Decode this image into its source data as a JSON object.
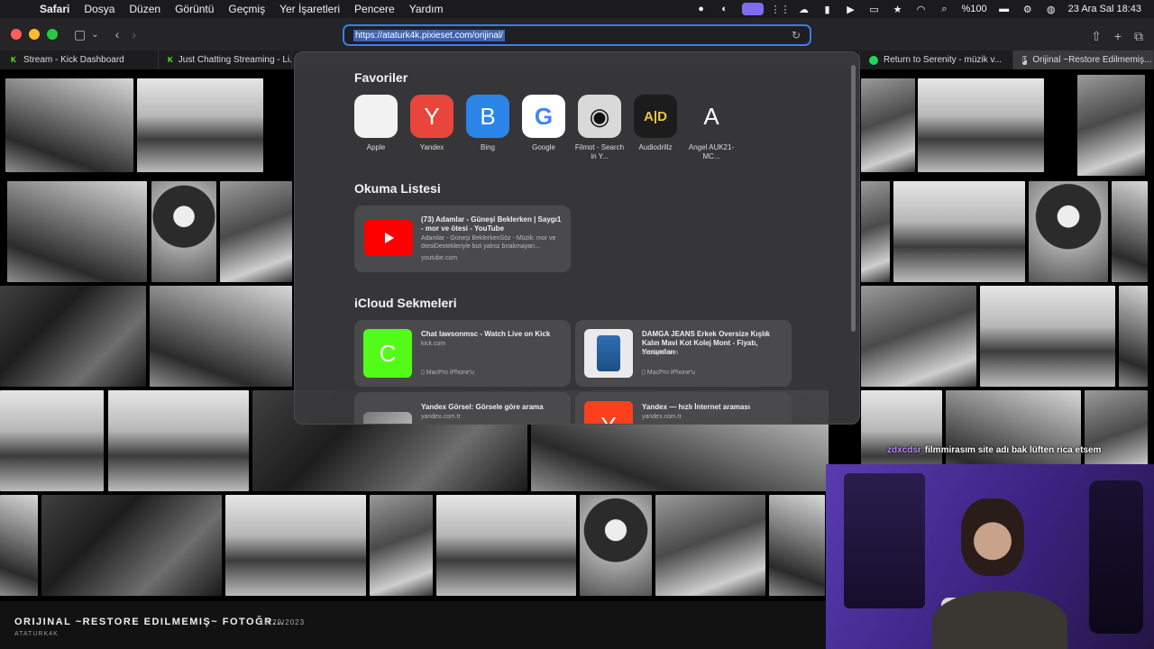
{
  "menubar": {
    "app": "Safari",
    "items": [
      "Dosya",
      "Düzen",
      "Görüntü",
      "Geçmiş",
      "Yer İşaretleri",
      "Pencere",
      "Yardım"
    ],
    "battery": "%100",
    "datetime": "23 Ara Sal  18:43"
  },
  "toolbar": {
    "url": "https://ataturk4k.pixieset.com/orijinal/"
  },
  "tabs": [
    {
      "label": "Stream - Kick Dashboard"
    },
    {
      "label": "Just Chatting Streaming - Li..."
    },
    {
      "label": "Return to Serenity - müzik v..."
    },
    {
      "label": "Orijinal ~Restore Edilmemiş..."
    }
  ],
  "start_page": {
    "favorites_title": "Favoriler",
    "favorites": [
      {
        "label": "Apple",
        "glyph": ""
      },
      {
        "label": "Yandex",
        "glyph": "Y"
      },
      {
        "label": "Bing",
        "glyph": "B"
      },
      {
        "label": "Google",
        "glyph": "G"
      },
      {
        "label": "Filmot - Search in Y...",
        "glyph": "◉"
      },
      {
        "label": "Audiodrillz",
        "glyph": "A|D"
      },
      {
        "label": "Angel AUK21-MC...",
        "glyph": "A"
      }
    ],
    "reading_list_title": "Okuma Listesi",
    "reading_list": [
      {
        "title": "(73) Adamlar - Güneşi Beklerken | Saygı1 - mor ve ötesi - YouTube",
        "desc": "Adamlar - Güneşi BeklerkenSöz - Müzik: mor ve ötesiDestekleriyle bizi yalnız bırakmayan...",
        "url": "youtube.com"
      }
    ],
    "icloud_title": "iCloud Sekmeleri",
    "icloud_tabs": [
      {
        "title": "Chat lawsonmsc - Watch Live on Kick",
        "url": "kick.com",
        "device": "MacPro iPhone'u",
        "thumb": "C"
      },
      {
        "title": "DAMGA JEANS Erkek Oversize Kışlık Kalın Mavi Kot Kolej Mont - Fiyatı, Yorumları",
        "url": "trendyol.com",
        "device": "MacPro iPhone'u",
        "thumb": ""
      },
      {
        "title": "Yandex Görsel: Görsele göre arama",
        "url": "yandex.com.tr",
        "device": "",
        "thumb": ""
      },
      {
        "title": "Yandex — hızlı İnternet araması",
        "url": "yandex.com.tr",
        "device": "",
        "thumb": "Y"
      }
    ]
  },
  "gallery_footer": {
    "title": "ORIJINAL ~RESTORE EDILMEMIŞ~ FOTOĞR...",
    "date": "10/29/2023",
    "subtitle": "ATATURK4K"
  },
  "stream_overlay": {
    "chat_user": "zdxcdsr",
    "chat_message": "filmmirasım site adı bak lüften rica etsem"
  },
  "colors": {
    "accent": "#3c7bf0",
    "youtube": "#ff0000",
    "kick": "#53fc18",
    "yandex": "#fc3f1d",
    "bing": "#2b84e8"
  }
}
